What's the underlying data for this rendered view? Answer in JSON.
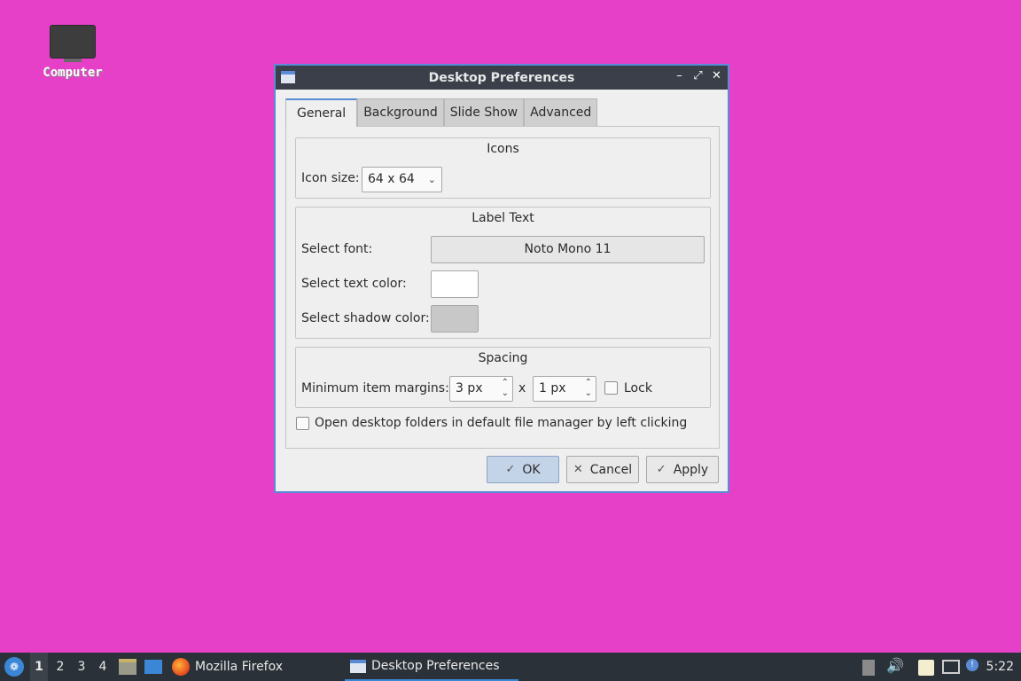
{
  "desktop": {
    "computer_label": "Computer"
  },
  "window": {
    "title": "Desktop Preferences",
    "controls": {
      "minimize": "–",
      "maximize": "⤢",
      "close": "✕"
    }
  },
  "tabs": [
    {
      "label": "General",
      "active": true
    },
    {
      "label": "Background",
      "active": false
    },
    {
      "label": "Slide Show",
      "active": false
    },
    {
      "label": "Advanced",
      "active": false
    }
  ],
  "icons_group": {
    "title": "Icons",
    "icon_size_label": "Icon size:",
    "icon_size_value": "64 x 64"
  },
  "label_text_group": {
    "title": "Label Text",
    "font_label": "Select font:",
    "font_value": "Noto Mono 11",
    "text_color_label": "Select text color:",
    "text_color": "#ffffff",
    "shadow_color_label": "Select shadow color:",
    "shadow_color": "#c8c8c8"
  },
  "spacing_group": {
    "title": "Spacing",
    "margins_label": "Minimum item margins:",
    "margin_x": "3 px",
    "separator": "x",
    "margin_y": "1 px",
    "lock_label": "Lock",
    "lock_checked": false
  },
  "open_folders": {
    "label": "Open desktop folders in default file manager by left clicking",
    "checked": false
  },
  "buttons": {
    "ok": "OK",
    "cancel": "Cancel",
    "apply": "Apply"
  },
  "taskbar": {
    "workspaces": [
      "1",
      "2",
      "3",
      "4"
    ],
    "active_workspace": "1",
    "tasks": [
      {
        "label": "Mozilla Firefox",
        "icon": "firefox-icon",
        "active": false
      },
      {
        "label": "Desktop Preferences",
        "icon": "window-icon",
        "active": true
      }
    ],
    "clock": "5:22"
  },
  "colors": {
    "desktop_background": "#e640c8",
    "accent": "#5a8bd6",
    "titlebar": "#3a3f4a",
    "taskbar": "#2b3138"
  }
}
